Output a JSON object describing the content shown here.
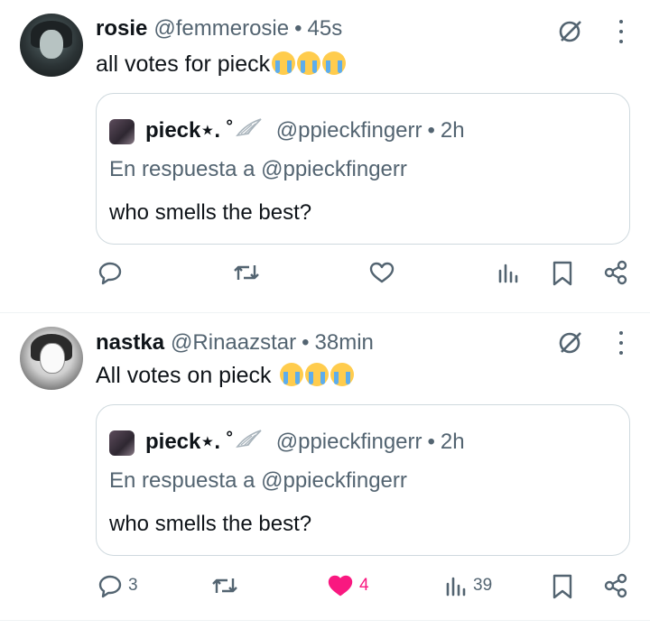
{
  "tweets": [
    {
      "author": {
        "name": "rosie",
        "handle": "@femmerosie",
        "time": "45s"
      },
      "text": "all votes for pieck",
      "emojis": [
        "loudly-crying-face",
        "loudly-crying-face",
        "loudly-crying-face"
      ],
      "quote": {
        "author": {
          "name": "pieck⋆. ˚",
          "handle": "@ppieckfingerr",
          "time": "2h"
        },
        "reply_to": "En respuesta a @ppieckfingerr",
        "text": "who smells the best?"
      },
      "actions": {
        "replies": "",
        "retweets": "",
        "likes": "",
        "views": "",
        "liked": false
      }
    },
    {
      "author": {
        "name": "nastka",
        "handle": "@Rinaazstar",
        "time": "38min"
      },
      "text": "All votes on pieck",
      "emojis": [
        "loudly-crying-face",
        "loudly-crying-face",
        "loudly-crying-face"
      ],
      "quote": {
        "author": {
          "name": "pieck⋆. ˚",
          "handle": "@ppieckfingerr",
          "time": "2h"
        },
        "reply_to": "En respuesta a @ppieckfingerr",
        "text": "who smells the best?"
      },
      "actions": {
        "replies": "3",
        "retweets": "",
        "likes": "4",
        "views": "39",
        "liked": true
      }
    }
  ],
  "separator": "•",
  "colors": {
    "like_active": "#f91880",
    "muted": "#536471",
    "text": "#0f1419",
    "border": "#cfd9de"
  },
  "icons": [
    "grok-icon",
    "more-icon",
    "reply-icon",
    "retweet-icon",
    "like-icon",
    "views-icon",
    "bookmark-icon",
    "share-icon",
    "wing-icon"
  ]
}
